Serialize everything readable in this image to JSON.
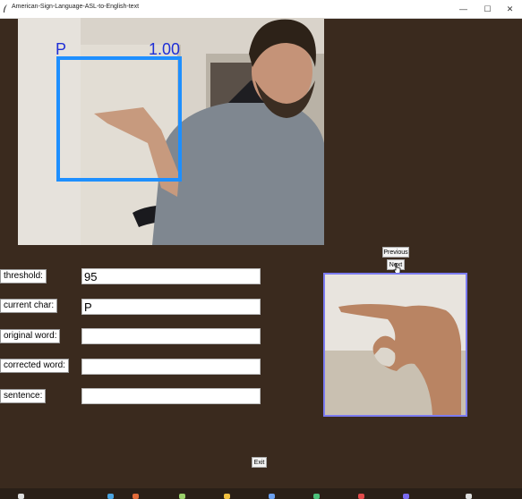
{
  "window": {
    "title": "American-Sign-Language-ASL-to-English-text",
    "icon": "feather-icon",
    "controls": {
      "minimize": "—",
      "maximize": "☐",
      "close": "✕"
    }
  },
  "camera": {
    "prediction_char": "P",
    "prediction_score": "1.00",
    "box_color": "#1e8fff",
    "text_color": "#1f2fd6"
  },
  "fields": {
    "threshold": {
      "label": "threshold:",
      "value": "95"
    },
    "current_char": {
      "label": "current char:",
      "value": "P"
    },
    "original_word": {
      "label": "original word:",
      "value": ""
    },
    "corrected_word": {
      "label": "corrected word:",
      "value": ""
    },
    "sentence": {
      "label": "sentence:",
      "value": ""
    }
  },
  "buttons": {
    "previous": "Previous",
    "next": "Next",
    "exit": "Exit"
  },
  "colors": {
    "background": "#3a2a1e",
    "suggestion_border": "#7b7bf0"
  }
}
